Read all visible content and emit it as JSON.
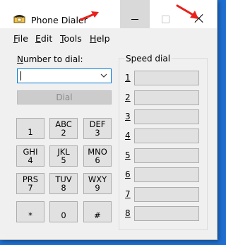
{
  "window": {
    "title": "Phone Dialer",
    "controls": [
      "minimize",
      "maximize",
      "close"
    ]
  },
  "menu": [
    {
      "label": "File",
      "mnemonic": "F",
      "rest": "ile"
    },
    {
      "label": "Edit",
      "mnemonic": "E",
      "rest": "dit"
    },
    {
      "label": "Tools",
      "mnemonic": "T",
      "rest": "ools"
    },
    {
      "label": "Help",
      "mnemonic": "H",
      "rest": "elp"
    }
  ],
  "dialer": {
    "number_label_mnemonic": "N",
    "number_label_rest": "umber to dial:",
    "number_value": "",
    "dial_button": "Dial"
  },
  "keypad": [
    {
      "letters": "",
      "digit": "1"
    },
    {
      "letters": "ABC",
      "digit": "2"
    },
    {
      "letters": "DEF",
      "digit": "3"
    },
    {
      "letters": "GHI",
      "digit": "4"
    },
    {
      "letters": "JKL",
      "digit": "5"
    },
    {
      "letters": "MNO",
      "digit": "6"
    },
    {
      "letters": "PRS",
      "digit": "7"
    },
    {
      "letters": "TUV",
      "digit": "8"
    },
    {
      "letters": "WXY",
      "digit": "9"
    },
    {
      "letters": "",
      "digit": "*"
    },
    {
      "letters": "",
      "digit": "0"
    },
    {
      "letters": "",
      "digit": "#"
    }
  ],
  "speed_dial": {
    "label": "Speed dial",
    "numbers": [
      "1",
      "2",
      "3",
      "4",
      "5",
      "6",
      "7",
      "8"
    ]
  },
  "colors": {
    "annotation_arrow": "#e8211c",
    "desktop": "#1f6fd1",
    "focus_border": "#0078d7"
  },
  "icons": {
    "app": "phone-icon",
    "combo_arrow": "chevron-down-icon"
  }
}
